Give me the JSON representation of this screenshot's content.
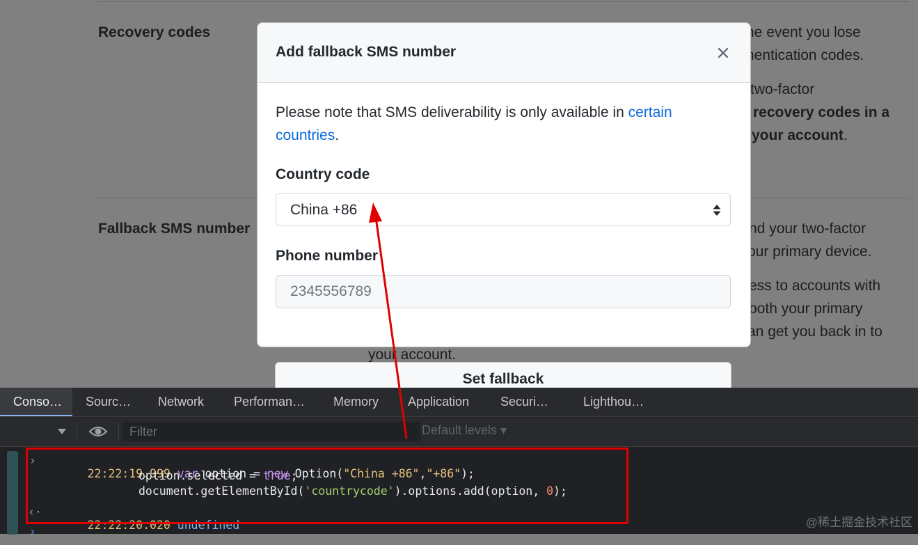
{
  "background": {
    "recovery_title": "Recovery codes",
    "recovery_lines": [
      "he event you lose",
      "hentication codes.",
      "two-factor"
    ],
    "recovery_bold_1": "recovery codes in a",
    "recovery_bold_2": "your account",
    "recovery_bold_2_suffix": ".",
    "fallback_title": "Fallback SMS number",
    "fallback_lines": [
      "nd your two-factor",
      "our primary device.",
      "ess to accounts with",
      "both your primary",
      "an get you back in to",
      "your account."
    ]
  },
  "modal": {
    "title": "Add fallback SMS number",
    "note_prefix": "Please note that SMS deliverability is only available in ",
    "note_link": "certain countries",
    "note_suffix": ".",
    "country_label": "Country code",
    "country_value": "China +86",
    "phone_label": "Phone number",
    "phone_placeholder": "2345556789",
    "submit_label": "Set fallback"
  },
  "devtools": {
    "tabs": [
      "Conso…",
      "Sourc…",
      "Network",
      "Performan…",
      "Memory",
      "Application",
      "Securi…",
      "Lighthou…"
    ],
    "active_tab": "Conso…",
    "filter_placeholder": "Filter",
    "levels_label": "Default levels ▾",
    "console": {
      "input_timestamp": "22:22:19.999",
      "output_timestamp": "22:22:20.020",
      "output_value": "undefined"
    },
    "watermark": "@稀土掘金技术社区"
  },
  "colors": {
    "link": "#0969da",
    "highlight": "#e00000",
    "active_tab_indicator": "#8ab4f8"
  }
}
